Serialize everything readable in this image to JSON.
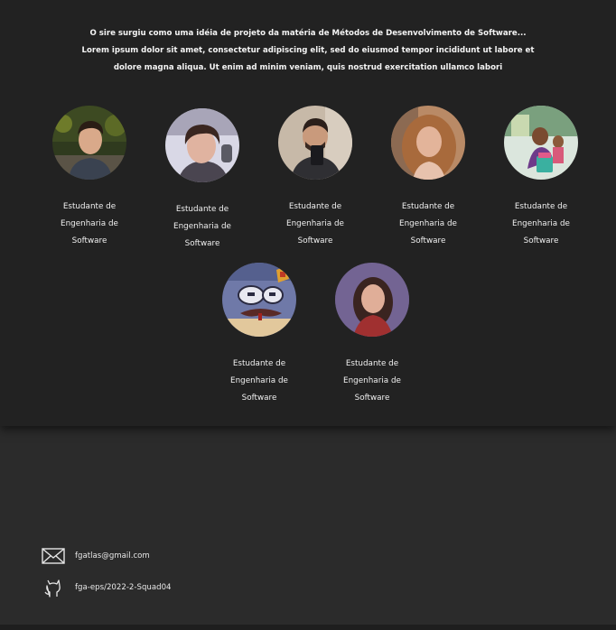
{
  "intro": {
    "line1": "O sire surgiu como uma idéia de projeto da matéria de Métodos de Desenvolvimento de Software...",
    "line2": "Lorem ipsum dolor sit amet, consectetur adipiscing elit, sed do eiusmod tempor incididunt ut labore et",
    "line3": "dolore magna aliqua. Ut enim ad minim veniam, quis nostrud exercitation ullamco labori"
  },
  "members": [
    {
      "role1": "Estudante de",
      "role2": "Engenharia de",
      "role3": "Software"
    },
    {
      "role1": "Estudante de",
      "role2": "Engenharia de",
      "role3": "Software"
    },
    {
      "role1": "Estudante de",
      "role2": "Engenharia de",
      "role3": "Software"
    },
    {
      "role1": "Estudante de",
      "role2": "Engenharia de",
      "role3": "Software"
    },
    {
      "role1": "Estudante de",
      "role2": "Engenharia de",
      "role3": "Software"
    },
    {
      "role1": "Estudante de",
      "role2": "Engenharia de",
      "role3": "Software"
    },
    {
      "role1": "Estudante de",
      "role2": "Engenharia de",
      "role3": "Software"
    }
  ],
  "footer": {
    "email": "fgatlas@gmail.com",
    "email_icon": "envelope-icon",
    "repo": "fga-eps/2022-2-Squad04",
    "repo_icon": "github-icon"
  }
}
